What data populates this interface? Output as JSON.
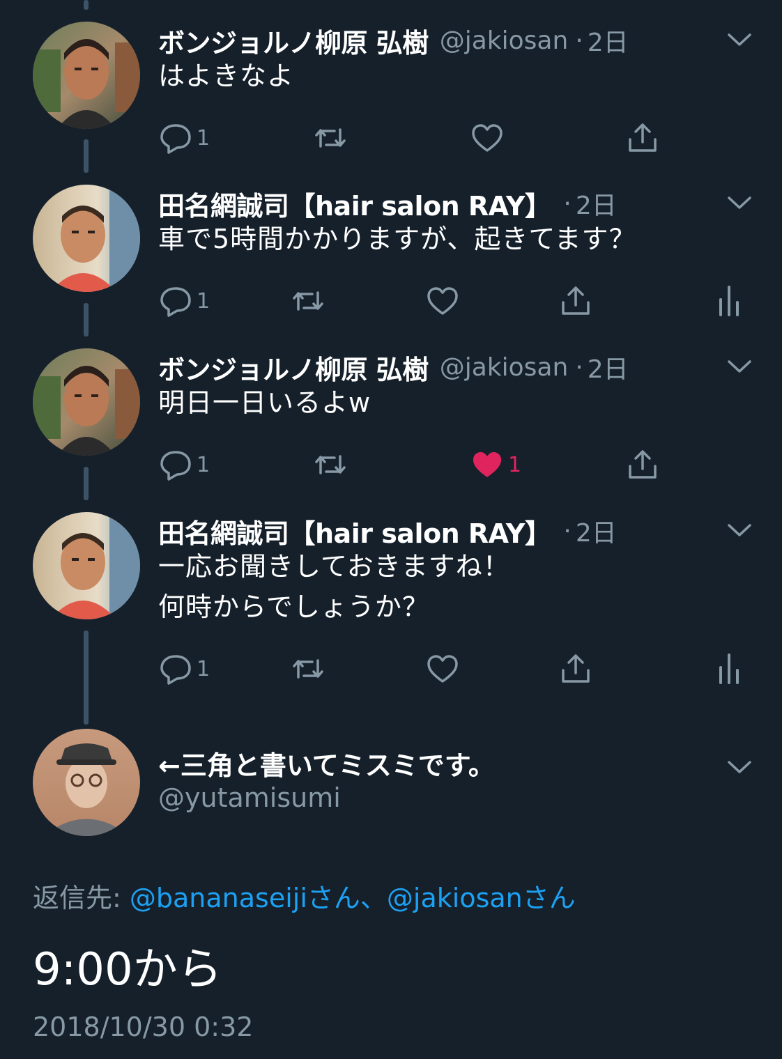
{
  "thread": [
    {
      "name": "ボンジョルノ柳原 弘樹",
      "handle": "@jakiosan",
      "separator": "·",
      "time": "2日",
      "lines": [
        "はよきなよ"
      ],
      "reply_count": "1",
      "retweet_count": "",
      "like_count": "",
      "liked": false,
      "has_analytics": false,
      "avatar": "person-avatar-1"
    },
    {
      "name": "田名網誠司【hair salon RAY】",
      "handle": "",
      "separator": "·",
      "time": "2日",
      "lines": [
        "車で5時間かかりますが、起きてます？"
      ],
      "reply_count": "1",
      "retweet_count": "",
      "like_count": "",
      "liked": false,
      "has_analytics": true,
      "avatar": "person-avatar-2"
    },
    {
      "name": "ボンジョルノ柳原 弘樹",
      "handle": "@jakiosan",
      "separator": "·",
      "time": "2日",
      "lines": [
        "明日一日いるよw"
      ],
      "reply_count": "1",
      "retweet_count": "",
      "like_count": "1",
      "liked": true,
      "has_analytics": false,
      "avatar": "person-avatar-1"
    },
    {
      "name": "田名網誠司【hair salon RAY】",
      "handle": "",
      "separator": "·",
      "time": "2日",
      "lines": [
        "一応お聞きしておきますね！",
        "何時からでしょうか？"
      ],
      "reply_count": "1",
      "retweet_count": "",
      "like_count": "",
      "liked": false,
      "has_analytics": true,
      "avatar": "person-avatar-2"
    }
  ],
  "main_tweet": {
    "name": "←三角と書いてミスミです。",
    "handle": "@yutamisumi",
    "reply_label": "返信先: ",
    "reply_user_1": "@bananaseijiさん",
    "reply_sep": "、",
    "reply_user_2": "@jakiosanさん",
    "text": "9:00から",
    "timestamp": "2018/10/30 0:32"
  },
  "colors": {
    "background": "#15202b",
    "text_primary": "#ffffff",
    "text_secondary": "#8899a6",
    "accent_link": "#1da1f2",
    "like_red": "#e0245e",
    "thread_line": "#3d5466"
  },
  "icons": [
    "reply-icon",
    "retweet-icon",
    "like-icon",
    "share-icon",
    "analytics-icon",
    "chevron-down-icon"
  ]
}
